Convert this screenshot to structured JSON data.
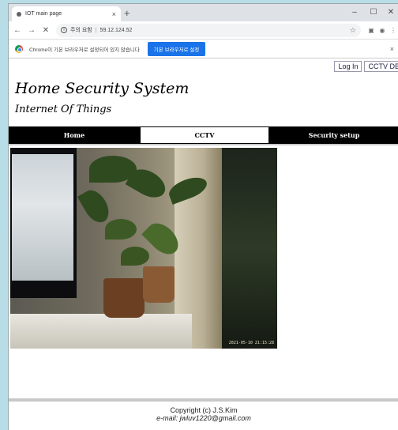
{
  "browser": {
    "tab_title": "IOT main page",
    "tab_close": "×",
    "new_tab": "+",
    "minimize": "–",
    "maximize": "☐",
    "close": "✕",
    "security_label": "주의 요함",
    "url": "59.12.124.52",
    "infobar_text": "Chrome이 기본 브라우저로 설정되어 있지 않습니다",
    "infobar_button": "기본 브라우저로 설정",
    "infobar_close": "×"
  },
  "page": {
    "login_label": "Log In",
    "cctv_db_label": "CCTV DB",
    "title": "Home Security System",
    "subtitle": "Internet Of Things",
    "nav": {
      "home": "Home",
      "cctv": "CCTV",
      "security": "Security setup"
    },
    "camera_timestamp": "2021-05-10 21:15:28",
    "footer": {
      "copyright": "Copyright (c) J.S.Kim",
      "email": "e-mail: jwluv1220@gmail.com"
    }
  }
}
